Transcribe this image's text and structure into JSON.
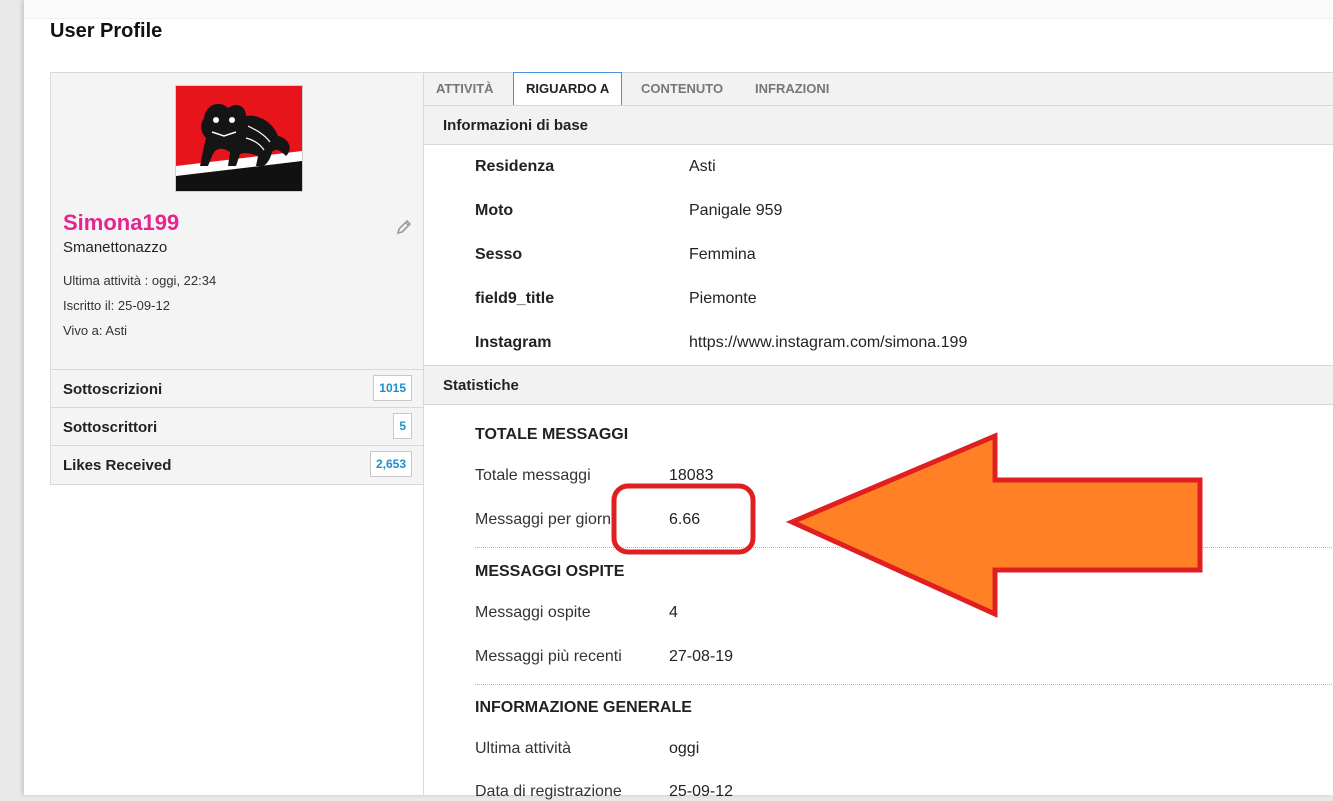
{
  "page": {
    "title": "User Profile"
  },
  "profile": {
    "username": "Simona199",
    "usertitle": "Smanettonazzo",
    "last_activity": "Ultima attività  : oggi, 22:34",
    "joined": "Iscritto il: 25-09-12",
    "location": "Vivo a: Asti",
    "stats": [
      {
        "label": "Sottoscrizioni",
        "count": "1015"
      },
      {
        "label": "Sottoscrittori",
        "count": "5"
      },
      {
        "label": "Likes Received",
        "count": "2,653"
      }
    ]
  },
  "tabs": [
    "ATTIVITÀ",
    "RIGUARDO A",
    "CONTENUTO",
    "INFRAZIONI"
  ],
  "basic_info": {
    "heading": "Informazioni di base",
    "rows": [
      {
        "label": "Residenza",
        "value": "Asti"
      },
      {
        "label": "Moto",
        "value": "Panigale 959"
      },
      {
        "label": "Sesso",
        "value": "Femmina"
      },
      {
        "label": "field9_title",
        "value": "Piemonte"
      },
      {
        "label": "Instagram",
        "value": "https://www.instagram.com/simona.199"
      }
    ]
  },
  "statistics": {
    "heading": "Statistiche",
    "total_messages": {
      "title": "TOTALE MESSAGGI",
      "rows": [
        {
          "label": "Totale messaggi",
          "value": "18083"
        },
        {
          "label": "Messaggi per giorno",
          "value": "6.66"
        }
      ]
    },
    "guest_messages": {
      "title": "MESSAGGI OSPITE",
      "rows": [
        {
          "label": "Messaggi ospite",
          "value": "4"
        },
        {
          "label": "Messaggi più recenti",
          "value": "27-08-19"
        }
      ]
    },
    "general_info": {
      "title": "INFORMAZIONE GENERALE",
      "rows": [
        {
          "label": "Ultima attività",
          "value": "oggi"
        },
        {
          "label": "Data di registrazione",
          "value": "25-09-12"
        }
      ]
    }
  },
  "colors": {
    "username": "#e7238d",
    "count": "#1a8fc9",
    "annotation_red": "#e02020",
    "annotation_orange": "#ff8025"
  },
  "icons": {
    "edit": "pencil-icon"
  }
}
